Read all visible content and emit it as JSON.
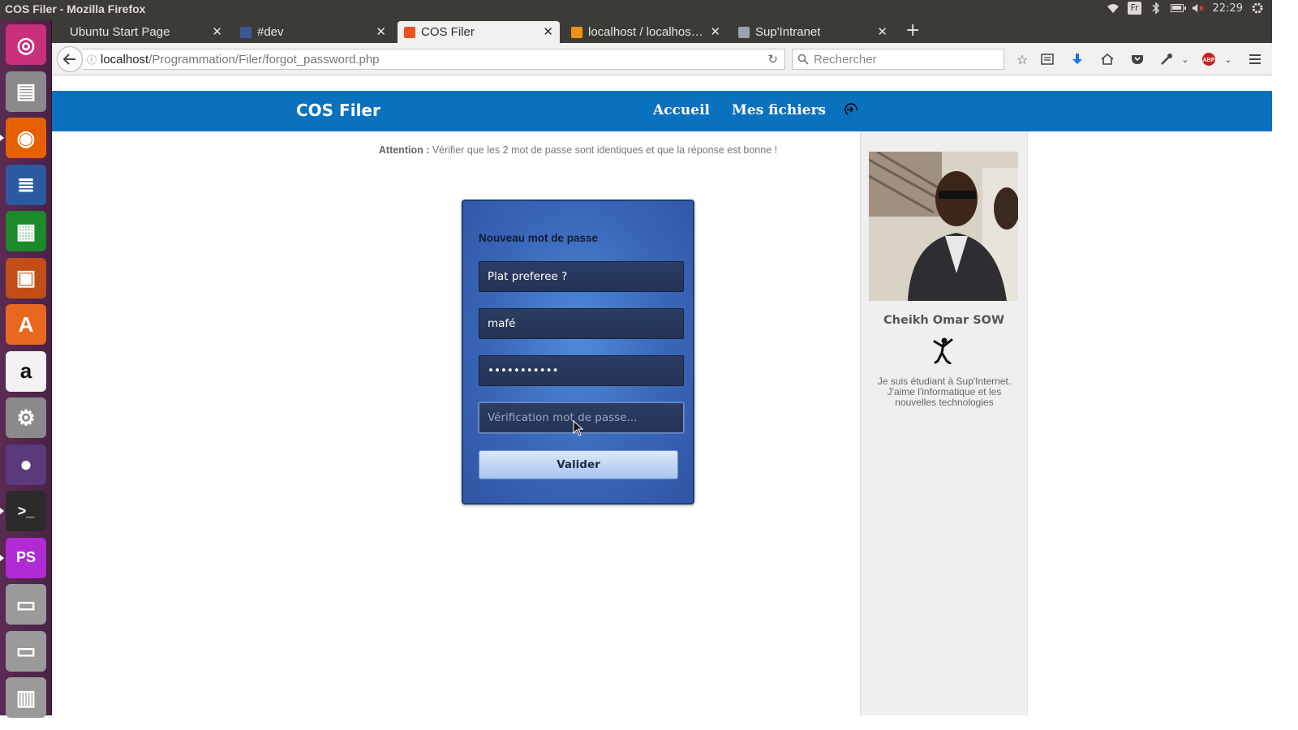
{
  "os": {
    "window_title": "COS Filer - Mozilla Firefox",
    "keyboard_layout": "Fr",
    "clock": "22:29",
    "tray_icons": [
      "wifi-icon",
      "keyboard-layout-badge",
      "bluetooth-icon",
      "battery-icon",
      "volume-muted-icon",
      "settings-gear-icon"
    ],
    "launcher_items": [
      {
        "name": "ubuntu-dash-icon",
        "color": "#c8307b"
      },
      {
        "name": "files-icon",
        "color": "#8a8a8a"
      },
      {
        "name": "firefox-icon",
        "color": "#e66000"
      },
      {
        "name": "writer-icon",
        "color": "#2c5aa0"
      },
      {
        "name": "calc-icon",
        "color": "#1a8a2a"
      },
      {
        "name": "impress-icon",
        "color": "#c24d17"
      },
      {
        "name": "software-center-icon",
        "color": "#e8681f"
      },
      {
        "name": "amazon-icon",
        "color": "#f2f2f2"
      },
      {
        "name": "system-settings-icon",
        "color": "#8a8a8a"
      },
      {
        "name": "screencast-icon",
        "color": "#5a3a7a"
      },
      {
        "name": "terminal-icon",
        "color": "#2b2b2b"
      },
      {
        "name": "phpstorm-icon",
        "color": "#b02bd4"
      },
      {
        "name": "drive-icon",
        "color": "#9a9a9a"
      },
      {
        "name": "drive-icon-2",
        "color": "#9a9a9a"
      },
      {
        "name": "trash-icon",
        "color": "#9a9a9a"
      }
    ]
  },
  "browser": {
    "tabs": [
      {
        "label": "Ubuntu Start Page",
        "active": false
      },
      {
        "label": "#dev",
        "active": false
      },
      {
        "label": "COS Filer",
        "active": true
      },
      {
        "label": "localhost / localhos…",
        "active": false
      },
      {
        "label": "Sup'Intranet",
        "active": false
      }
    ],
    "url_host": "localhost",
    "url_path": "/Programmation/Filer/forgot_password.php",
    "search_placeholder": "Rechercher"
  },
  "page": {
    "site_title": "COS Filer",
    "nav": {
      "home": "Accueil",
      "files": "Mes fichiers"
    },
    "attention_label": "Attention :",
    "attention_text": " Vérifier que les 2 mot de passe sont identiques et que la réponse est bonne !",
    "form": {
      "title": "Nouveau mot de passe",
      "question_value": "Plat preferee ?",
      "answer_value": "mafé",
      "password_value": "•••••••••••",
      "confirm_placeholder": "Vérification mot de passe...",
      "submit_label": "Valider"
    },
    "profile": {
      "name": "Cheikh Omar SOW",
      "bio": "Je suis étudiant à Sup'Internet. J'aime l'informatique et les nouvelles technologies"
    }
  },
  "colors": {
    "header_blue": "#0a71bf",
    "card_blue": "#3a66b8",
    "launcher_purple": "#5b2b52",
    "panel_dark": "#3c3b37"
  }
}
